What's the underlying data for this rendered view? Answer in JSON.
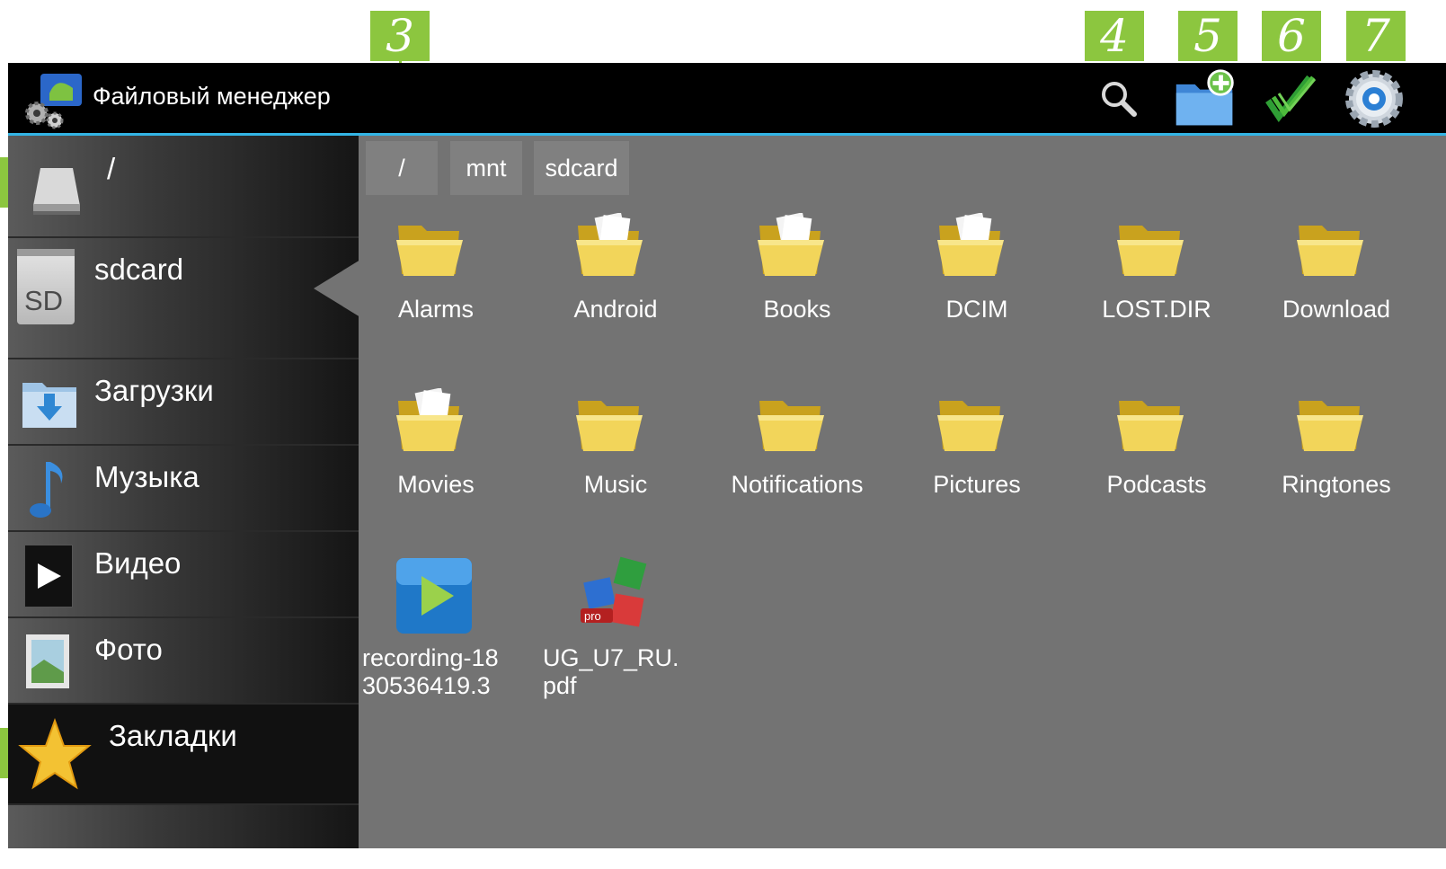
{
  "callouts": {
    "three": "3",
    "four": "4",
    "five": "5",
    "six": "6",
    "seven": "7"
  },
  "actionbar": {
    "title": "Файловый менеджер",
    "icons": [
      "app-gears-icon",
      "search-icon",
      "new-folder-icon",
      "multi-select-icon",
      "settings-icon"
    ]
  },
  "sidebar": {
    "items": [
      {
        "label": "/",
        "icon": "drive-icon"
      },
      {
        "label": "sdcard",
        "icon": "sd-card-icon",
        "icon_text": "SD",
        "selected": true
      },
      {
        "label": "Загрузки",
        "icon": "downloads-icon"
      },
      {
        "label": "Музыка",
        "icon": "music-note-icon"
      },
      {
        "label": "Видео",
        "icon": "video-play-icon"
      },
      {
        "label": "Фото",
        "icon": "photo-icon"
      },
      {
        "label": "Закладки",
        "icon": "star-icon"
      }
    ]
  },
  "breadcrumb": [
    "/",
    "mnt",
    "sdcard"
  ],
  "files": {
    "row1": [
      "Alarms",
      "Android",
      "Books",
      "DCIM",
      "LOST.DIR",
      "Download"
    ],
    "row2": [
      "Movies",
      "Music",
      "Notifications",
      "Pictures",
      "Podcasts",
      "Ringtones"
    ],
    "row3": [
      "recording-18\n30536419.3",
      "UG_U7_RU.\npdf"
    ],
    "pro_badge": "pro"
  },
  "colors": {
    "accent_blue": "#33b5e5",
    "callout_green": "#8cc63f",
    "panel_gray": "#737373"
  }
}
